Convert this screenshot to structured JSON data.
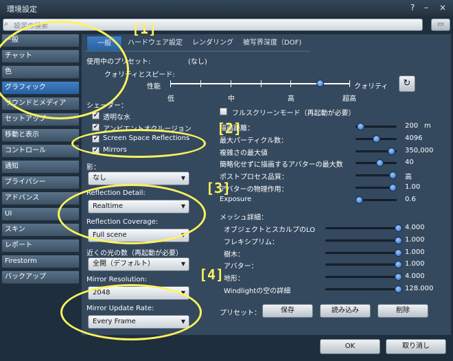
{
  "window": {
    "title": "環境設定",
    "help_icon": "?",
    "minimize_icon": "–",
    "close_icon": "×"
  },
  "search": {
    "placeholder": "設定の検索"
  },
  "sidebar": {
    "items": [
      {
        "label": "一般"
      },
      {
        "label": "チャット"
      },
      {
        "label": "色"
      },
      {
        "label": "グラフィック",
        "selected": true
      },
      {
        "label": "サウンドとメディア"
      },
      {
        "label": "セットアップ"
      },
      {
        "label": "移動と表示"
      },
      {
        "label": "コントロール"
      },
      {
        "label": "通知"
      },
      {
        "label": "プライバシー"
      },
      {
        "label": "アドバンス"
      },
      {
        "label": "UI"
      },
      {
        "label": "スキン"
      },
      {
        "label": "レポート"
      },
      {
        "label": "Firestorm"
      },
      {
        "label": "バックアップ"
      }
    ]
  },
  "tabs": [
    {
      "label": "一般",
      "selected": true
    },
    {
      "label": "ハードウェア設定"
    },
    {
      "label": "レンダリング"
    },
    {
      "label": "被写界深度（DOF)"
    }
  ],
  "preset": {
    "label": "使用中のプリセット:",
    "value": "(なし)"
  },
  "quality": {
    "label": "クォリティとスピード:",
    "left": "性能",
    "right": "クォリティ",
    "ticks": [
      "低",
      "中",
      "高",
      "超高"
    ],
    "level": 0.835
  },
  "shaders": {
    "label": "シェーダー：",
    "items": [
      {
        "label": "透明な水",
        "checked": true
      },
      {
        "label": "アンビエントオクルージョン",
        "checked": true
      },
      {
        "label": "Screen Space Reflections",
        "checked": true
      },
      {
        "label": "Mirrors",
        "checked": true
      }
    ]
  },
  "dropdowns": {
    "shadow": {
      "label": "影：",
      "value": "なし"
    },
    "reflection_detail": {
      "label": "Reflection Detail:",
      "value": "Realtime"
    },
    "reflection_coverage": {
      "label": "Reflection Coverage:",
      "value": "Full scene"
    },
    "light": {
      "label": "近くの光の数（再起動が必要）",
      "value": "全開（デフォルト）"
    },
    "mirror_res": {
      "label": "Mirror Resolution:",
      "value": "2048"
    },
    "mirror_rate": {
      "label": "Mirror Update Rate:",
      "value": "Every Frame"
    }
  },
  "fullscreen": {
    "label": "フルスクリーンモード（再起動が必要）",
    "checked": false
  },
  "sliders": [
    {
      "label": "描画距離：",
      "value": "200",
      "unit": "m",
      "level": 0.05
    },
    {
      "label": "最大パーティクル数：",
      "value": "4096",
      "level": 0.5
    },
    {
      "label": "複雑さの最大値",
      "value": "350,000",
      "level": 0.95
    },
    {
      "label": "簡略化せずに描画するアバターの最大数",
      "value": "40",
      "level": 0.62
    },
    {
      "label": "ポストプロセス品質：",
      "value": "高",
      "level": 1.0
    },
    {
      "label": "アバターの物理作用：",
      "value": "1.00",
      "level": 1.0
    },
    {
      "label": "Exposure",
      "value": "0.6",
      "level": 0.0
    }
  ],
  "mesh": {
    "label": "メッシュ詳細：",
    "items": [
      {
        "label": "オブジェクトとスカルプのLO",
        "value": "4.000",
        "level": 1.0
      },
      {
        "label": "フレキシプリム：",
        "value": "1.000",
        "level": 1.0
      },
      {
        "label": "樹木：",
        "value": "1.000",
        "level": 1.0
      },
      {
        "label": "アバター：",
        "value": "1.000",
        "level": 1.0
      },
      {
        "label": "地形：",
        "value": "4.000",
        "level": 1.0
      },
      {
        "label": "Windlightの空の詳細",
        "value": "128.000",
        "level": 1.0
      }
    ]
  },
  "preset_buttons": {
    "label": "プリセット：",
    "save": "保存",
    "load": "読み込み",
    "delete": "削除"
  },
  "footer": {
    "ok": "OK",
    "cancel": "取り消し"
  },
  "annotations": [
    "[1]",
    "[2]",
    "[3]",
    "[4]"
  ]
}
